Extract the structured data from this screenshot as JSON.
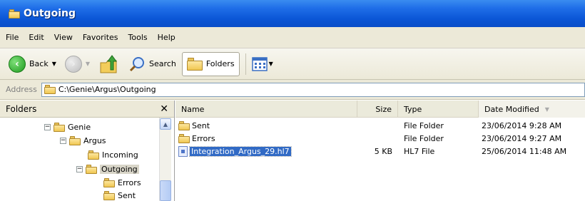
{
  "window": {
    "title": "Outgoing"
  },
  "menu": [
    "File",
    "Edit",
    "View",
    "Favorites",
    "Tools",
    "Help"
  ],
  "toolbar": {
    "back_label": "Back",
    "search_label": "Search",
    "folders_label": "Folders"
  },
  "address": {
    "label": "Address",
    "path": "C:\\Genie\\Argus\\Outgoing"
  },
  "folders_pane": {
    "title": "Folders",
    "close_glyph": "✕",
    "tree": [
      {
        "label": "Genie",
        "expander": "−"
      },
      {
        "label": "Argus",
        "expander": "−"
      },
      {
        "label": "Incoming",
        "expander": ""
      },
      {
        "label": "Outgoing",
        "expander": "−"
      },
      {
        "label": "Errors",
        "expander": ""
      },
      {
        "label": "Sent",
        "expander": ""
      }
    ]
  },
  "file_list": {
    "columns": {
      "name": "Name",
      "size": "Size",
      "type": "Type",
      "date": "Date Modified"
    },
    "rows": [
      {
        "name": "Sent",
        "size": "",
        "type": "File Folder",
        "date": "23/06/2014 9:28 AM",
        "icon": "folder-icon"
      },
      {
        "name": "Errors",
        "size": "",
        "type": "File Folder",
        "date": "23/06/2014 9:27 AM",
        "icon": "folder-icon"
      },
      {
        "name": "Integration_Argus_29.hl7",
        "size": "5 KB",
        "type": "HL7 File",
        "date": "25/06/2014 11:48 AM",
        "icon": "file-icon"
      }
    ]
  },
  "colors": {
    "title_bar": "#0b56d6",
    "selection": "#316ac5",
    "chrome": "#ece9d8"
  }
}
